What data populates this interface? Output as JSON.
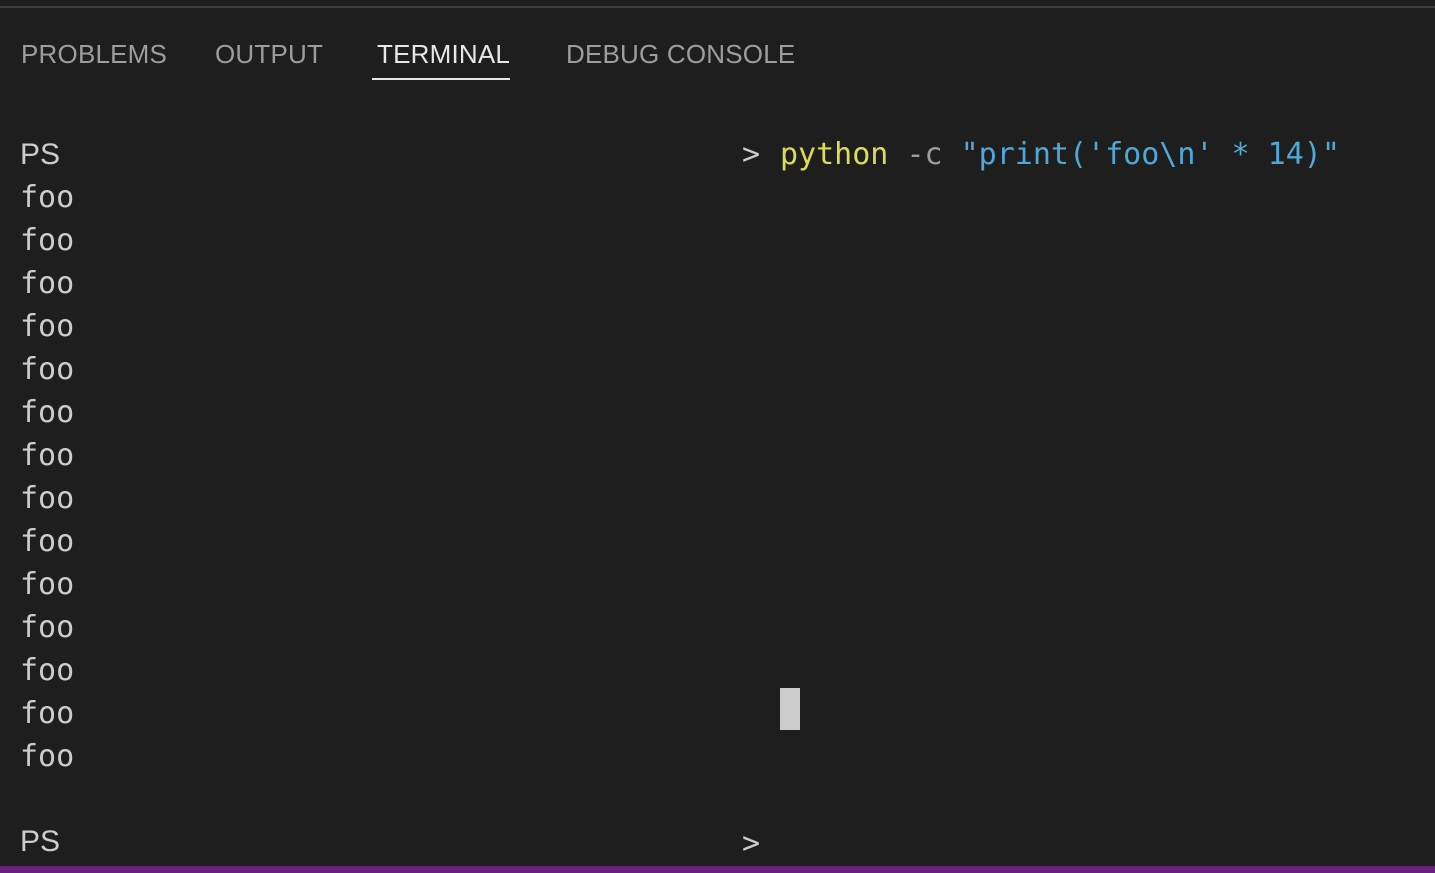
{
  "tabs": [
    {
      "label": "PROBLEMS",
      "active": false
    },
    {
      "label": "OUTPUT",
      "active": false
    },
    {
      "label": "TERMINAL",
      "active": true
    },
    {
      "label": "DEBUG CONSOLE",
      "active": false
    }
  ],
  "terminal": {
    "prompt_ps": "PS",
    "prompt_gt": ">",
    "command": {
      "program": "python",
      "flag": "-c",
      "argument": "\"print('foo\\n' * 14)\""
    },
    "output_lines": [
      "foo",
      "foo",
      "foo",
      "foo",
      "foo",
      "foo",
      "foo",
      "foo",
      "foo",
      "foo",
      "foo",
      "foo",
      "foo",
      "foo"
    ],
    "second_prompt_ps": "PS",
    "second_prompt_gt": ">"
  },
  "colors": {
    "background": "#1e1e1e",
    "text": "#cccccc",
    "command": "#dcdc58",
    "flag": "#9d9d9d",
    "string": "#4fa8d8",
    "status_bar": "#68217a"
  },
  "icons": {
    "cursor": "terminal-cursor-block"
  }
}
